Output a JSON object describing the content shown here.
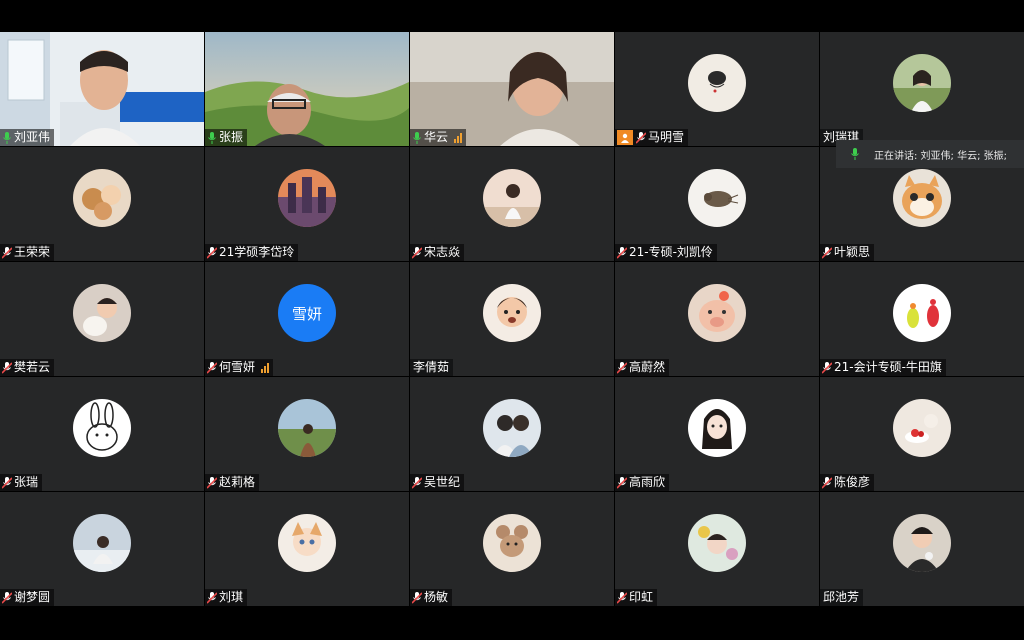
{
  "speaking_banner": "正在讲话: 刘亚伟; 华云; 张振;",
  "tiles": [
    {
      "name": "刘亚伟",
      "mic": "on",
      "video": true
    },
    {
      "name": "张振",
      "mic": "on",
      "video": true
    },
    {
      "name": "华云",
      "mic": "on",
      "video": true,
      "signal": true
    },
    {
      "name": "马明雪",
      "mic": "muted",
      "share": true,
      "avatar": "ink-bird"
    },
    {
      "name": "刘瑞琪",
      "mic": "none",
      "avatar": "girl-field"
    },
    {
      "name": "王荣荣",
      "mic": "muted",
      "avatar": "teddy-bears"
    },
    {
      "name": "21学硕李岱玲",
      "mic": "muted",
      "avatar": "city-sunset"
    },
    {
      "name": "宋志焱",
      "mic": "muted",
      "avatar": "girl-back"
    },
    {
      "name": "21-专硕-刘凯伶",
      "mic": "muted",
      "avatar": "bird-sketch"
    },
    {
      "name": "叶颖思",
      "mic": "muted",
      "avatar": "cat"
    },
    {
      "name": "樊若云",
      "mic": "muted",
      "avatar": "baby"
    },
    {
      "name": "何雪妍",
      "mic": "muted",
      "signal": true,
      "avatar_text": "雪妍"
    },
    {
      "name": "李倩茹",
      "mic": "none",
      "avatar": "toddler"
    },
    {
      "name": "高蔚然",
      "mic": "muted",
      "avatar": "pig"
    },
    {
      "name": "21-会计专硕-牛田旗",
      "mic": "muted",
      "avatar": "cartoon-pair"
    },
    {
      "name": "张瑞",
      "mic": "muted",
      "avatar": "rabbit"
    },
    {
      "name": "赵莉格",
      "mic": "muted",
      "avatar": "girl-hill"
    },
    {
      "name": "吴世纪",
      "mic": "muted",
      "avatar": "couple"
    },
    {
      "name": "高雨欣",
      "mic": "muted",
      "avatar": "anime-girl"
    },
    {
      "name": "陈俊彦",
      "mic": "muted",
      "avatar": "dessert"
    },
    {
      "name": "谢梦圆",
      "mic": "muted",
      "avatar": "girl-beach"
    },
    {
      "name": "刘琪",
      "mic": "muted",
      "avatar": "anime-fox"
    },
    {
      "name": "杨敏",
      "mic": "muted",
      "avatar": "mouse"
    },
    {
      "name": "印虹",
      "mic": "muted",
      "avatar": "flower-girl"
    },
    {
      "name": "邱池芳",
      "mic": "none",
      "avatar": "kid-eating"
    }
  ],
  "colors": {
    "tile_bg": "#262728",
    "mic_on": "#3ecf4e",
    "mic_muted": "#e84a4a",
    "share_badge": "#f08a24",
    "text_avatar": "#1a7cf5"
  }
}
